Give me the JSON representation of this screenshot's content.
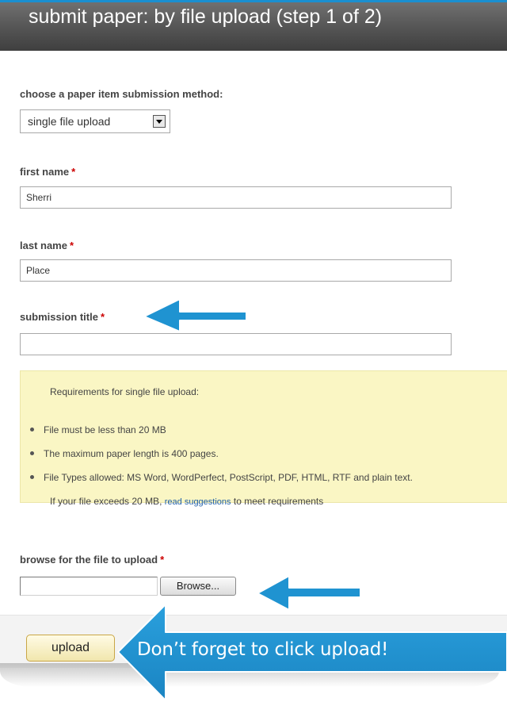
{
  "header": {
    "title": "submit paper: by file upload (step 1 of 2)"
  },
  "method": {
    "label": "choose a paper item submission method:",
    "selected": "single file upload"
  },
  "fields": {
    "first_name": {
      "label": "first name",
      "value": "Sherri",
      "required_mark": "*"
    },
    "last_name": {
      "label": "last name",
      "value": "Place",
      "required_mark": "*"
    },
    "submission_title": {
      "label": "submission title",
      "value": "",
      "required_mark": "*"
    }
  },
  "requirements": {
    "intro": "Requirements for single file upload:",
    "items": [
      "File must be less than 20 MB",
      "The maximum paper length is 400 pages.",
      "File Types allowed: MS Word, WordPerfect, PostScript, PDF, HTML, RTF and plain text."
    ],
    "note_prefix": "If your file exceeds 20 MB,",
    "note_link": "read suggestions",
    "note_suffix": "to meet requirements"
  },
  "file_upload": {
    "label": "browse for the file to upload",
    "required_mark": "*",
    "value": "",
    "browse_label": "Browse..."
  },
  "actions": {
    "upload_label": "upload"
  },
  "annotation": {
    "callout_text": "Don’t forget to click upload!",
    "arrow_color": "#1f93d1"
  },
  "colors": {
    "header_accent": "#1a8fd0",
    "required": "#cc0000",
    "requirements_bg": "#faf6c4",
    "link": "#1f5fa8"
  }
}
